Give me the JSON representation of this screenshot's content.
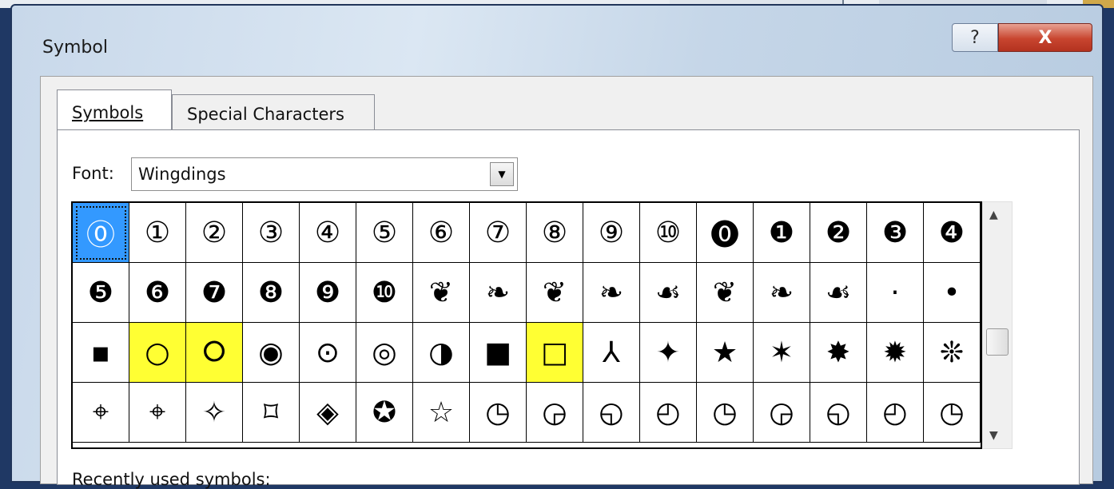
{
  "window": {
    "title": "Symbol",
    "help_label": "?",
    "close_label": "X"
  },
  "tabs": [
    {
      "label": "Symbols",
      "active": true
    },
    {
      "label": "Special Characters",
      "active": false
    }
  ],
  "font": {
    "label": "Font:",
    "value": "Wingdings",
    "dropdown_glyph": "▼"
  },
  "grid": {
    "rows": [
      [
        "⓪",
        "①",
        "②",
        "③",
        "④",
        "⑤",
        "⑥",
        "⑦",
        "⑧",
        "⑨",
        "⑩",
        "⓿",
        "❶",
        "❷",
        "❸",
        "❹"
      ],
      [
        "❺",
        "❻",
        "❼",
        "❽",
        "❾",
        "❿",
        "❦",
        "❧",
        "❦",
        "❧",
        "☙",
        "❦",
        "❧",
        "☙",
        "·",
        "•"
      ],
      [
        "▪",
        "○",
        "⭘",
        "◉",
        "⊙",
        "◎",
        "◑",
        "■",
        "□",
        "⅄",
        "✦",
        "★",
        "✶",
        "✸",
        "✹",
        "❊"
      ],
      [
        "⌖",
        "⌖",
        "✧",
        "⌑",
        "◈",
        "✪",
        "☆",
        "◷",
        "◶",
        "◵",
        "◴",
        "◷",
        "◶",
        "◵",
        "◴",
        "◷"
      ]
    ],
    "selected": [
      0,
      0
    ],
    "highlighted": [
      [
        2,
        1
      ],
      [
        2,
        2
      ],
      [
        2,
        8
      ]
    ]
  },
  "scrollbar": {
    "up_glyph": "▲",
    "down_glyph": "▼"
  },
  "recently_used_label": "Recently used symbols:"
}
